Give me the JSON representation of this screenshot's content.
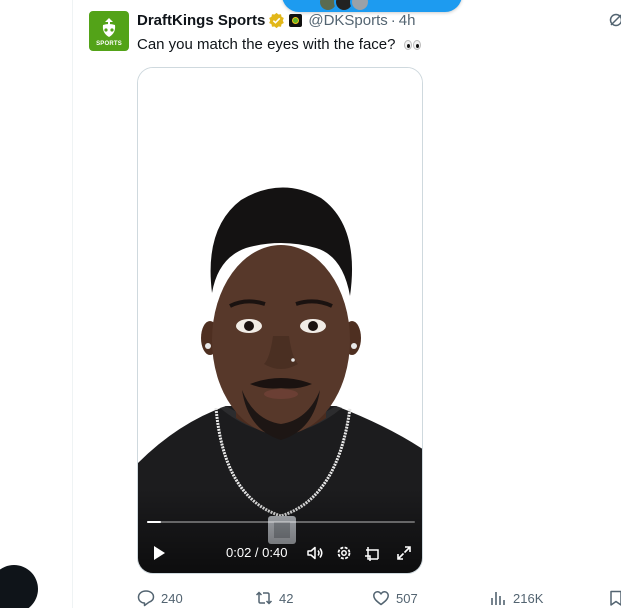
{
  "banner": {
    "label": ""
  },
  "tweet": {
    "author_name": "DraftKings Sports",
    "author_handle": "@DKSports",
    "separator": "·",
    "timestamp": "4h",
    "text": "Can you match the eyes with the face?",
    "avatar_label": "SPORTS",
    "verified": "gold-check"
  },
  "video": {
    "time_display": "0:02 / 0:40",
    "progress_fraction": 0.053
  },
  "actions": {
    "replies": "240",
    "reposts": "42",
    "likes": "507",
    "views": "216K"
  },
  "colors": {
    "accent": "#1d9bf0",
    "brand_green": "#53a318",
    "verified_gold": "#e2b719",
    "secondary_text": "#536471"
  },
  "icons": [
    "grok-icon",
    "play-icon",
    "volume-icon",
    "settings-icon",
    "pip-icon",
    "fullscreen-icon",
    "reply-icon",
    "repost-icon",
    "like-icon",
    "views-icon",
    "bookmark-icon"
  ]
}
